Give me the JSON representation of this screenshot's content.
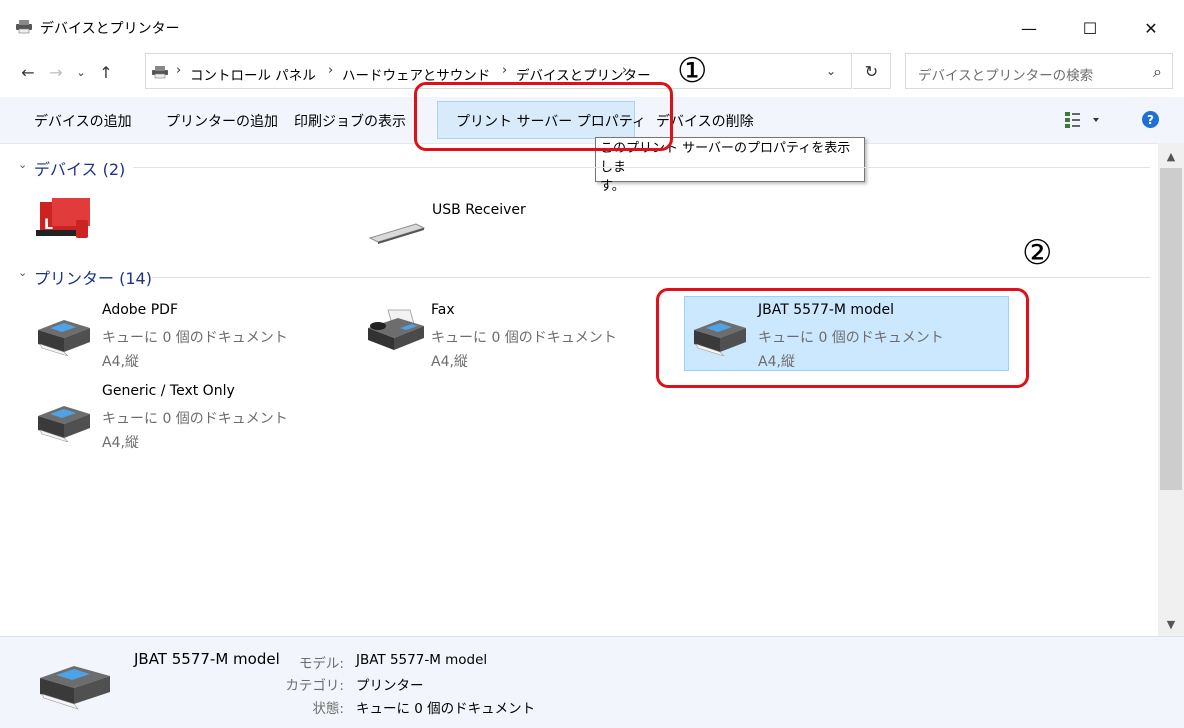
{
  "window": {
    "title": "デバイスとプリンター",
    "buttons": {
      "minimize": "—",
      "maximize": "☐",
      "close": "✕"
    }
  },
  "address": {
    "crumbs": [
      "コントロール パネル",
      "ハードウェアとサウンド",
      "デバイスとプリンター"
    ],
    "search_placeholder": "デバイスとプリンターの検索"
  },
  "commands": {
    "add_device": "デバイスの追加",
    "add_printer": "プリンターの追加",
    "print_jobs": "印刷ジョブの表示",
    "print_server_props": "プリント サーバー プロパティ",
    "remove_device": "デバイスの削除"
  },
  "tooltip": {
    "line1": "このプリント サーバーのプロパティを表示しま",
    "line2": "す。"
  },
  "groups": {
    "devices": {
      "header": "デバイス (2)",
      "items": [
        {
          "name": ""
        },
        {
          "name": "USB Receiver"
        }
      ]
    },
    "printers": {
      "header": "プリンター (14)",
      "items": [
        {
          "name": "Adobe PDF",
          "queue": "キューに 0 個のドキュメント",
          "paper": "A4,縦"
        },
        {
          "name": "Fax",
          "queue": "キューに 0 個のドキュメント",
          "paper": "A4,縦"
        },
        {
          "name": "JBAT 5577-M model",
          "queue": "キューに 0 個のドキュメント",
          "paper": "A4,縦"
        },
        {
          "name": "Generic / Text Only",
          "queue": "キューに 0 個のドキュメント",
          "paper": "A4,縦"
        }
      ]
    }
  },
  "annotations": {
    "one": "①",
    "two": "②"
  },
  "details": {
    "name": "JBAT 5577-M model",
    "model_label": "モデル:",
    "model_value": "JBAT 5577-M model",
    "category_label": "カテゴリ:",
    "category_value": "プリンター",
    "status_label": "状態:",
    "status_value": "キューに 0 個のドキュメント"
  },
  "colors": {
    "accent": "#1e3287",
    "selection": "#cce8ff",
    "annotation": "#e0101a"
  }
}
